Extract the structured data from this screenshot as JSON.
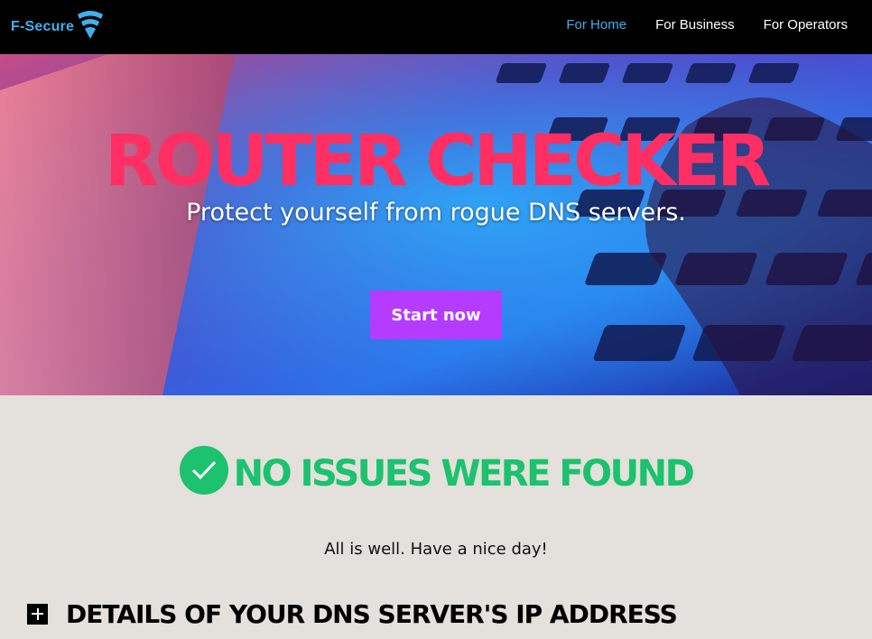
{
  "header": {
    "logo_text": "F-Secure",
    "logo_icon": "fsecure-wifi-shield-icon",
    "nav": [
      {
        "label": "For Home",
        "active": true
      },
      {
        "label": "For Business",
        "active": false
      },
      {
        "label": "For Operators",
        "active": false
      }
    ]
  },
  "hero": {
    "title": "ROUTER CHECKER",
    "subtitle": "Protect yourself from rogue DNS servers.",
    "cta_label": "Start now",
    "background": "keyboard-photo"
  },
  "result": {
    "status_icon": "checkmark-circle-icon",
    "title": "NO ISSUES WERE FOUND",
    "message": "All is well. Have a nice day!"
  },
  "details": {
    "toggle_icon": "plus-icon",
    "title": "DETAILS OF YOUR DNS SERVER'S IP ADDRESS"
  },
  "colors": {
    "topbar": "#000000",
    "brand_blue": "#3fb0ec",
    "hero_title": "#ff2f63",
    "cta": "#b53bff",
    "success": "#1cc26e",
    "page_bg": "#e4e0dc"
  }
}
